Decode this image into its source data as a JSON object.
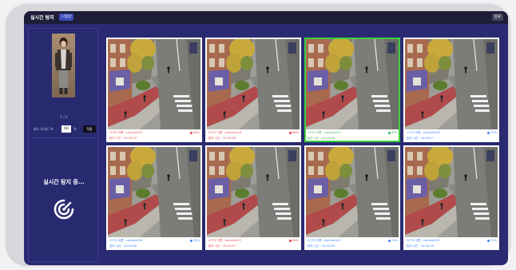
{
  "header": {
    "title": "실시간 탐지",
    "mode_button": "나침반",
    "exit_button": "종료"
  },
  "left_panel": {
    "page_indicator": "1 / 1",
    "threshold_label": "최소 유사도 %",
    "threshold_value": "60",
    "threshold_unit": "%",
    "apply_button": "적용",
    "status_text": "실시간 탐지 중..."
  },
  "colors": {
    "red": "#e8464c",
    "blue": "#3b82f6",
    "green": "#37b24d"
  },
  "icons": {
    "status": "radar-search-icon"
  },
  "detections": [
    {
      "camera": "CCTV 이름 : camera013",
      "time": "탐지 시간 : 10:23:45",
      "score": "98%",
      "status": "red",
      "matched": false
    },
    {
      "camera": "CCTV 이름 : camera014",
      "time": "탐지 시간 : 10:23:46",
      "score": "88%",
      "status": "red",
      "matched": false
    },
    {
      "camera": "CCTV 이름 : camera015",
      "time": "탐지 시간 : 10:23:46",
      "score": "99%",
      "status": "green",
      "matched": true
    },
    {
      "camera": "CCTV 이름 : camera016",
      "time": "탐지 시간 : 10:23:47",
      "score": "79%",
      "status": "blue",
      "matched": false
    },
    {
      "camera": "CCTV 이름 : camera018",
      "time": "탐지 시간 : 10:23:48",
      "score": "76%",
      "status": "blue",
      "matched": false
    },
    {
      "camera": "CCTV 이름 : camera017",
      "time": "탐지 시간 : 10:23:47",
      "score": "89%",
      "status": "red",
      "matched": false
    },
    {
      "camera": "CCTV 이름 : camera019",
      "time": "탐지 시간 : 10:23:49",
      "score": "74%",
      "status": "blue",
      "matched": false
    },
    {
      "camera": "CCTV 이름 : camera020",
      "time": "탐지 시간 : 10:23:50",
      "score": "72%",
      "status": "blue",
      "matched": false
    }
  ]
}
